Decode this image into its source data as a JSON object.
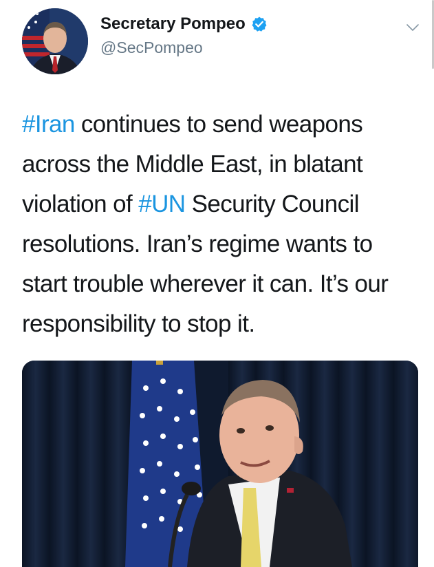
{
  "tweet": {
    "author": {
      "display_name": "Secretary Pompeo",
      "handle": "@SecPompeo",
      "verified": true,
      "avatar_icon": "avatar-photo"
    },
    "menu_icon": "chevron-down-icon",
    "text_segments": [
      {
        "text": "#Iran",
        "type": "hashtag"
      },
      {
        "text": " continues to send weapons across the Middle East, in blatant violation of ",
        "type": "text"
      },
      {
        "text": "#UN",
        "type": "hashtag"
      },
      {
        "text": " Security Council resolutions. Iran’s regime wants to start trouble wherever it can. It’s our responsibility to stop it.",
        "type": "text"
      }
    ],
    "media": {
      "type": "photo",
      "subject": "speaker-at-podium-with-flag"
    }
  },
  "colors": {
    "link": "#1b95e0",
    "verified": "#1da1f2",
    "handle": "#657786",
    "text": "#14171a"
  }
}
